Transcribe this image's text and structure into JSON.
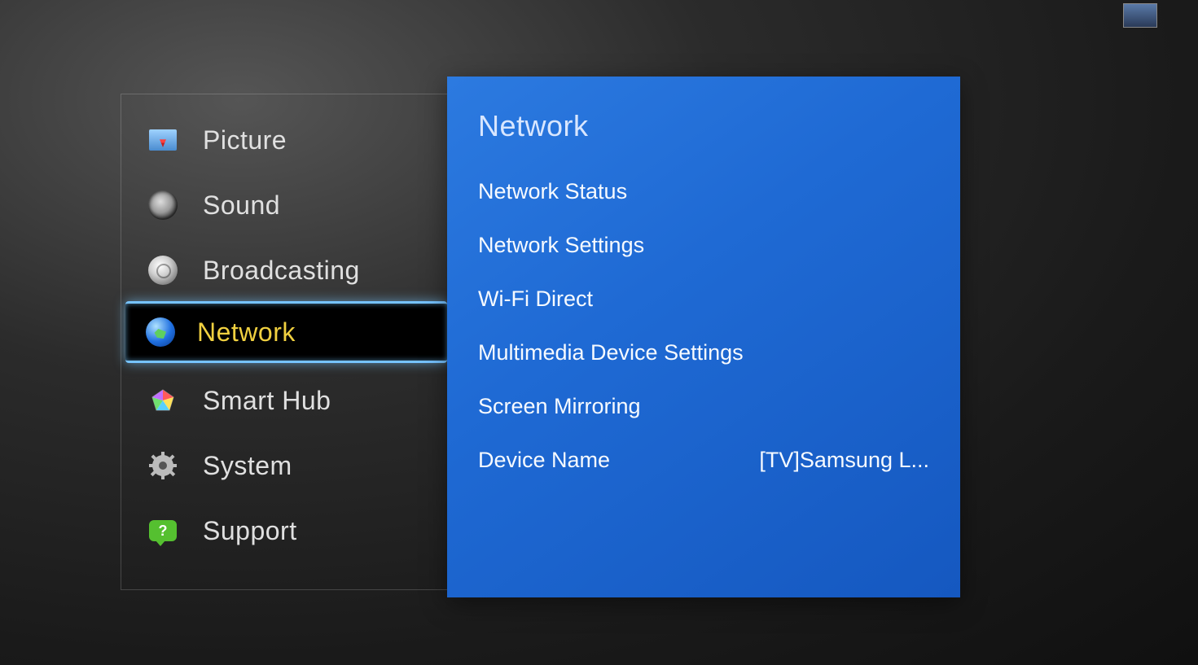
{
  "sidebar": {
    "items": [
      {
        "label": "Picture",
        "icon": "picture-icon"
      },
      {
        "label": "Sound",
        "icon": "sound-icon"
      },
      {
        "label": "Broadcasting",
        "icon": "broadcasting-icon"
      },
      {
        "label": "Network",
        "icon": "network-icon",
        "selected": true
      },
      {
        "label": "Smart Hub",
        "icon": "smarthub-icon"
      },
      {
        "label": "System",
        "icon": "system-icon"
      },
      {
        "label": "Support",
        "icon": "support-icon"
      }
    ]
  },
  "panel": {
    "title": "Network",
    "items": [
      {
        "label": "Network Status",
        "value": ""
      },
      {
        "label": "Network Settings",
        "value": ""
      },
      {
        "label": "Wi-Fi Direct",
        "value": ""
      },
      {
        "label": "Multimedia Device Settings",
        "value": ""
      },
      {
        "label": "Screen Mirroring",
        "value": ""
      },
      {
        "label": "Device Name",
        "value": "[TV]Samsung L..."
      }
    ]
  },
  "colors": {
    "accent": "#1f6ad4",
    "highlight_text": "#f0d040",
    "glow": "#76c3ff"
  }
}
